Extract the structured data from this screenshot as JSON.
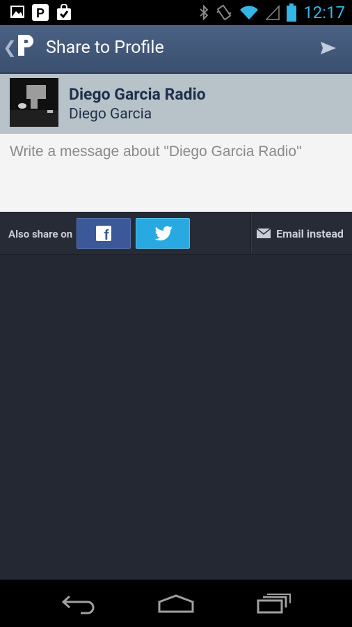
{
  "status_bar": {
    "time": "12:17",
    "left_icons": [
      "gallery-icon",
      "parking-icon",
      "shopping-bag-check-icon"
    ],
    "right_icons": [
      "bluetooth-icon",
      "vibrate-icon",
      "wifi-icon",
      "signal-icon",
      "battery-icon"
    ],
    "accent_color": "#33b5e5"
  },
  "action_bar": {
    "title": "Share to Profile",
    "logo_letter": "P"
  },
  "track": {
    "title": "Diego Garcia Radio",
    "artist": "Diego Garcia"
  },
  "message": {
    "placeholder": "Write a message about \"Diego Garcia Radio\"",
    "value": ""
  },
  "share": {
    "label": "Also share on",
    "facebook_glyph": "f",
    "email_label": "Email instead",
    "facebook_color": "#3b5998",
    "twitter_color": "#29a9e1"
  },
  "nav_bar": {
    "icons": [
      "back-icon",
      "home-icon",
      "recent-apps-icon"
    ]
  }
}
